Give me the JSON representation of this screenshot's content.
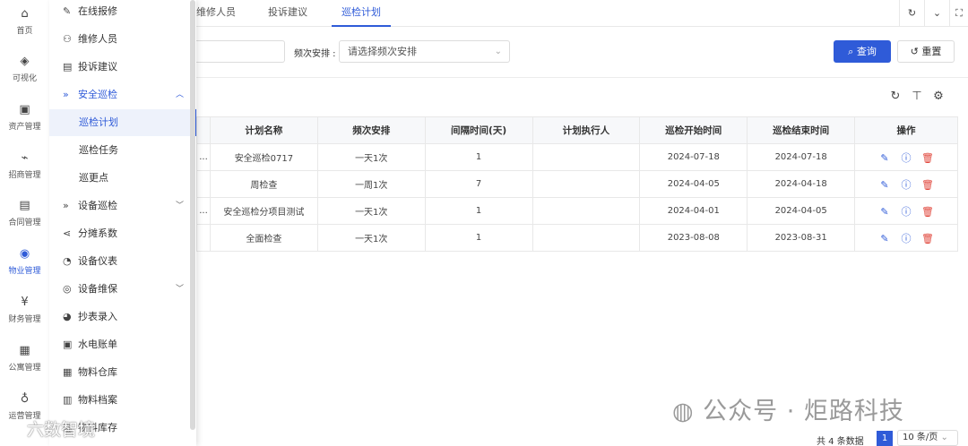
{
  "rail": [
    {
      "icon": "bank-icon",
      "glyph": "⌂",
      "label": "首页"
    },
    {
      "icon": "visual-icon",
      "glyph": "◈",
      "label": "可视化"
    },
    {
      "icon": "asset-icon",
      "glyph": "▣",
      "label": "资产管理"
    },
    {
      "icon": "chart-icon",
      "glyph": "⌁",
      "label": "招商管理"
    },
    {
      "icon": "contract-icon",
      "glyph": "▤",
      "label": "合同管理"
    },
    {
      "icon": "property-icon",
      "glyph": "◉",
      "label": "物业管理",
      "active": true
    },
    {
      "icon": "finance-icon",
      "glyph": "¥",
      "label": "财务管理"
    },
    {
      "icon": "apartment-icon",
      "glyph": "▦",
      "label": "公寓管理"
    },
    {
      "icon": "bulb-icon",
      "glyph": "♁",
      "label": "运营管理"
    }
  ],
  "submenu": [
    {
      "label": "在线报修",
      "icon": "wrench-icon",
      "glyph": "✎"
    },
    {
      "label": "维修人员",
      "icon": "user-icon",
      "glyph": "⚇"
    },
    {
      "label": "投诉建议",
      "icon": "doc-icon",
      "glyph": "▤"
    },
    {
      "label": "安全巡检",
      "icon": "double-chevron-icon",
      "glyph": "»",
      "expanded": true
    },
    {
      "label": "巡检计划",
      "child": true,
      "selected": true
    },
    {
      "label": "巡检任务",
      "child": true
    },
    {
      "label": "巡更点",
      "child": true
    },
    {
      "label": "设备巡检",
      "icon": "double-chevron-icon",
      "glyph": "»",
      "collapsible": true
    },
    {
      "label": "分摊系数",
      "icon": "share-icon",
      "glyph": "⋖"
    },
    {
      "label": "设备仪表",
      "icon": "gauge-icon",
      "glyph": "◔"
    },
    {
      "label": "设备维保",
      "icon": "watch-icon",
      "glyph": "◎",
      "collapsible": true
    },
    {
      "label": "抄表录入",
      "icon": "meter-icon",
      "glyph": "◕"
    },
    {
      "label": "水电账单",
      "icon": "bill-icon",
      "glyph": "▣"
    },
    {
      "label": "物料仓库",
      "icon": "grid-icon",
      "glyph": "▦"
    },
    {
      "label": "物料档案",
      "icon": "archive-icon",
      "glyph": "▥"
    },
    {
      "label": "物料库存",
      "icon": "stock-icon",
      "glyph": "▧"
    }
  ],
  "tabs": [
    {
      "label": "维修人员"
    },
    {
      "label": "投诉建议"
    },
    {
      "label": "巡检计划",
      "active": true
    }
  ],
  "filter": {
    "freq_label": "频次安排 :",
    "freq_placeholder": "请选择频次安排",
    "query_label": "查询",
    "reset_label": "重置"
  },
  "table": {
    "headers": [
      "计划名称",
      "频次安排",
      "间隔时间(天)",
      "计划执行人",
      "巡检开始时间",
      "巡检结束时间",
      "操作"
    ],
    "rows": [
      {
        "prefix": "...",
        "name": "安全巡检0717",
        "freq": "一天1次",
        "interval": "1",
        "executor": "",
        "start": "2024-07-18",
        "end": "2024-07-18"
      },
      {
        "prefix": "",
        "name": "周检查",
        "freq": "一周1次",
        "interval": "7",
        "executor": "",
        "start": "2024-04-05",
        "end": "2024-04-18"
      },
      {
        "prefix": "...",
        "name": "安全巡检分项目测试",
        "freq": "一天1次",
        "interval": "1",
        "executor": "",
        "start": "2024-04-01",
        "end": "2024-04-05"
      },
      {
        "prefix": "",
        "name": "全面检查",
        "freq": "一天1次",
        "interval": "1",
        "executor": "",
        "start": "2023-08-08",
        "end": "2023-08-31"
      }
    ]
  },
  "pagination": {
    "total": "共 4 条数据",
    "current": "1",
    "page_size": "10 条/页"
  },
  "watermark": {
    "right": "公众号 · 炬路科技",
    "left": "六数智境"
  },
  "colors": {
    "accent": "#2f5bd8",
    "danger": "#e0453a"
  }
}
